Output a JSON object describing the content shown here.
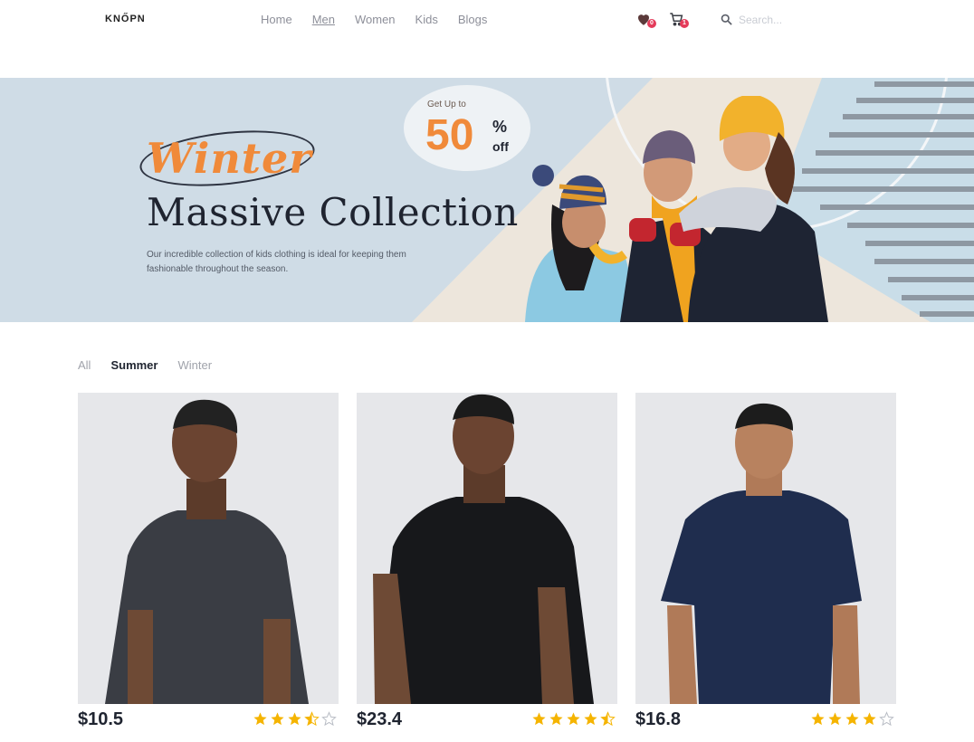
{
  "header": {
    "logo": "KNŐPN",
    "nav": [
      "Home",
      "Men",
      "Women",
      "Kids",
      "Blogs"
    ],
    "active_nav": "Men",
    "wishlist_count": "0",
    "cart_count": "1",
    "search_placeholder": "Search..."
  },
  "banner": {
    "script_word": "Winter",
    "headline": "Massive Collection",
    "subtext": "Our incredible collection of kids clothing is ideal for keeping them fashionable throughout the season.",
    "promo": {
      "prefix": "Get Up to",
      "value": "50",
      "percent": "%",
      "suffix": "off"
    }
  },
  "filters": {
    "items": [
      "All",
      "Summer",
      "Winter"
    ],
    "active": "Summer"
  },
  "products": [
    {
      "price": "$10.5",
      "rating": 3.5,
      "shirt_color": "#3a3d44"
    },
    {
      "price": "$23.4",
      "rating": 4.5,
      "shirt_color": "#17181b"
    },
    {
      "price": "$16.8",
      "rating": 4,
      "shirt_color": "#1f2d4e"
    }
  ],
  "colors": {
    "accent": "#f08a3a",
    "star": "#f5b400",
    "badge": "#e43b5a",
    "banner_bg": "#cfdce6"
  }
}
